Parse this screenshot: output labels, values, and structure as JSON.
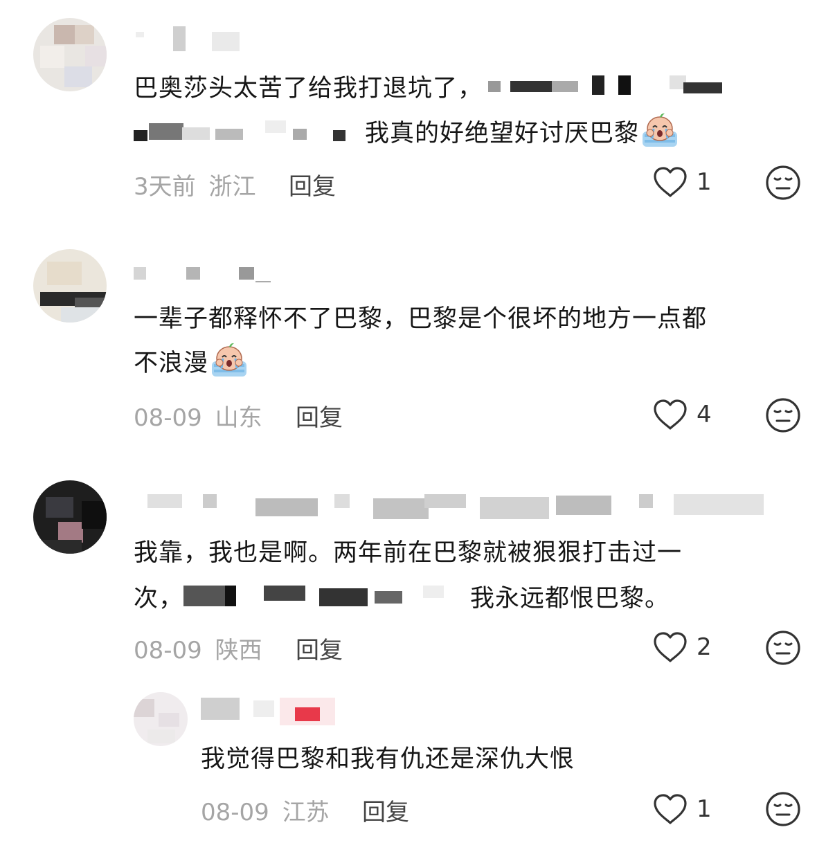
{
  "comments": [
    {
      "text_part1": "巴奥莎头太苦了给我打退坑了，",
      "text_part2": "我真的好绝望好讨厌巴黎",
      "time": "3天前",
      "region": "浙江",
      "reply_label": "回复",
      "likes": "1",
      "emoji": "crying-face-emoji"
    },
    {
      "text_line1": "一辈子都释怀不了巴黎，巴黎是个很坏的地方一点都",
      "text_line2": "不浪漫",
      "time": "08-09",
      "region": "山东",
      "reply_label": "回复",
      "likes": "4",
      "emoji": "crying-face-emoji"
    },
    {
      "text_line1": "我靠，我也是啊。两年前在巴黎就被狠狠打击过一",
      "text_part1": "次，",
      "text_part2": "我永远都恨巴黎。",
      "time": "08-09",
      "region": "陕西",
      "reply_label": "回复",
      "likes": "2"
    }
  ],
  "reply": {
    "text": "我觉得巴黎和我有仇还是深仇大恨",
    "time": "08-09",
    "region": "江苏",
    "reply_label": "回复",
    "likes": "1"
  },
  "icons": {
    "like": "heart-outline-icon",
    "dislike": "meh-face-icon"
  },
  "colors": {
    "text": "#161616",
    "meta": "#a5a5a5",
    "reply": "#444444",
    "badge": "#e8394a"
  }
}
